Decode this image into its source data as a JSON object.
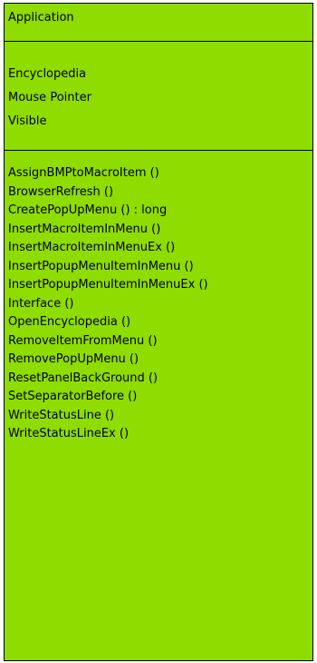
{
  "colors": {
    "box_fill": "#8fdc00",
    "border": "#000000",
    "text": "#000000"
  },
  "class_box": {
    "name": "Application",
    "attributes": [
      "Encyclopedia",
      "Mouse Pointer",
      "Visible"
    ],
    "operations": [
      "AssignBMPtoMacroItem ()",
      "BrowserRefresh ()",
      "CreatePopUpMenu () : long",
      "InsertMacroItemInMenu ()",
      "InsertMacroItemInMenuEx ()",
      "InsertPopupMenuItemInMenu ()",
      "InsertPopupMenuItemInMenuEx ()",
      "Interface ()",
      "OpenEncyclopedia ()",
      "RemoveItemFromMenu ()",
      "RemovePopUpMenu ()",
      "ResetPanelBackGround ()",
      "SetSeparatorBefore ()",
      "WriteStatusLine ()",
      "WriteStatusLineEx ()"
    ]
  }
}
